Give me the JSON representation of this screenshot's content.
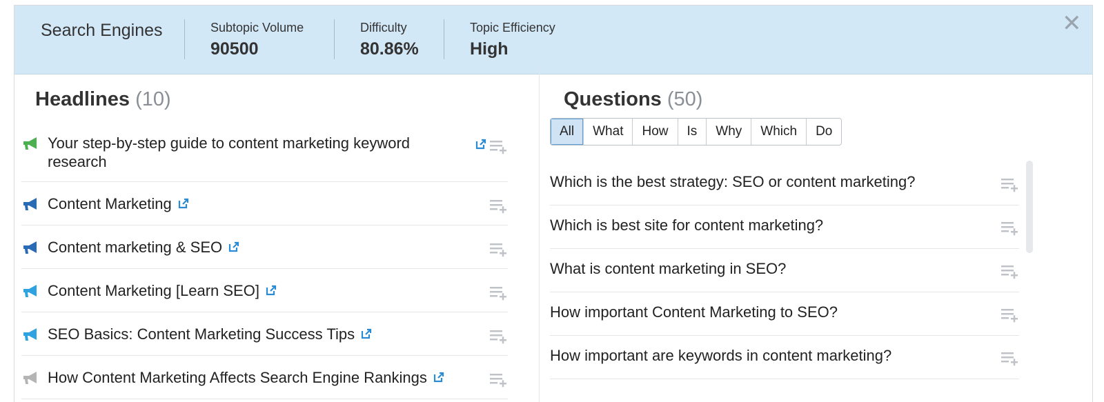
{
  "topbar": {
    "topic": "Search Engines",
    "metrics": [
      {
        "label": "Subtopic Volume",
        "value": "90500"
      },
      {
        "label": "Difficulty",
        "value": "80.86%"
      },
      {
        "label": "Topic Efficiency",
        "value": "High"
      }
    ],
    "close_glyph": "✕"
  },
  "headlines": {
    "title": "Headlines",
    "count": "(10)",
    "items": [
      {
        "text": "Your step-by-step guide to content marketing keyword research",
        "icon": "megaphone-icon",
        "icon_color": "#4caf50"
      },
      {
        "text": "Content Marketing",
        "icon": "megaphone-icon",
        "icon_color": "#2a6bb5"
      },
      {
        "text": "Content marketing & SEO",
        "icon": "megaphone-icon",
        "icon_color": "#2a6bb5"
      },
      {
        "text": "Content Marketing [Learn SEO]",
        "icon": "megaphone-icon",
        "icon_color": "#2ea3e0"
      },
      {
        "text": "SEO Basics: Content Marketing Success Tips",
        "icon": "megaphone-icon",
        "icon_color": "#2ea3e0"
      },
      {
        "text": "How Content Marketing Affects Search Engine Rankings",
        "icon": "megaphone-icon",
        "icon_color": "#b5b5b5"
      }
    ]
  },
  "questions": {
    "title": "Questions",
    "count": "(50)",
    "filters": [
      "All",
      "What",
      "How",
      "Is",
      "Why",
      "Which",
      "Do"
    ],
    "active_filter": "All",
    "items": [
      "Which is the best strategy: SEO or content marketing?",
      "Which is best site for content marketing?",
      "What is content marketing in SEO?",
      "How important Content Marketing to SEO?",
      "How important are keywords in content marketing?"
    ]
  },
  "colors": {
    "topbar_bg": "#d3e8f7",
    "link_icon": "#2a8ad4",
    "active_filter_bg": "#cfe3f5"
  }
}
